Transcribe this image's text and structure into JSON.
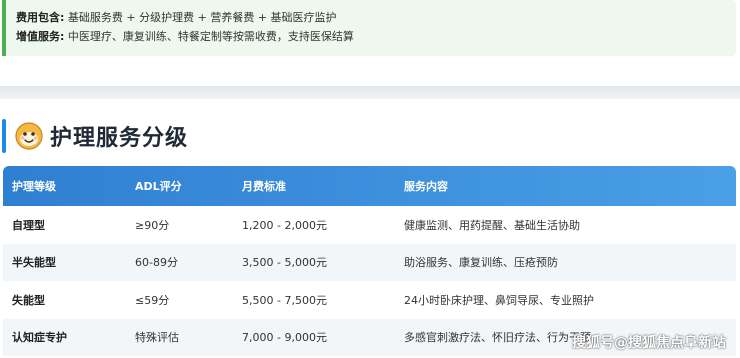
{
  "fees": {
    "included_label": "费用包含:",
    "included_text": "基础服务费 + 分级护理费 + 营养餐费 + 基础医疗监护",
    "extra_label": "增值服务:",
    "extra_text": "中医理疗、康复训练、特餐定制等按需收费，支持医保结算"
  },
  "section": {
    "title": "护理服务分级",
    "mascot_icon": "smiling-face-icon",
    "accent": "#1e88e5"
  },
  "table": {
    "headers": [
      "护理等级",
      "ADL评分",
      "月费标准",
      "服务内容"
    ],
    "rows": [
      [
        "自理型",
        "≥90分",
        "1,200 - 2,000元",
        "健康监测、用药提醒、基础生活协助"
      ],
      [
        "半失能型",
        "60-89分",
        "3,500 - 5,000元",
        "助浴服务、康复训练、压疮预防"
      ],
      [
        "失能型",
        "≤59分",
        "5,500 - 7,500元",
        "24小时卧床护理、鼻饲导尿、专业照护"
      ],
      [
        "认知症专护",
        "特殊评估",
        "7,000 - 9,000元",
        "多感官刺激疗法、怀旧疗法、行为干预"
      ]
    ],
    "header_color": "#2f7fd2"
  },
  "watermark": "搜狐号@搜狐焦点阜新站"
}
